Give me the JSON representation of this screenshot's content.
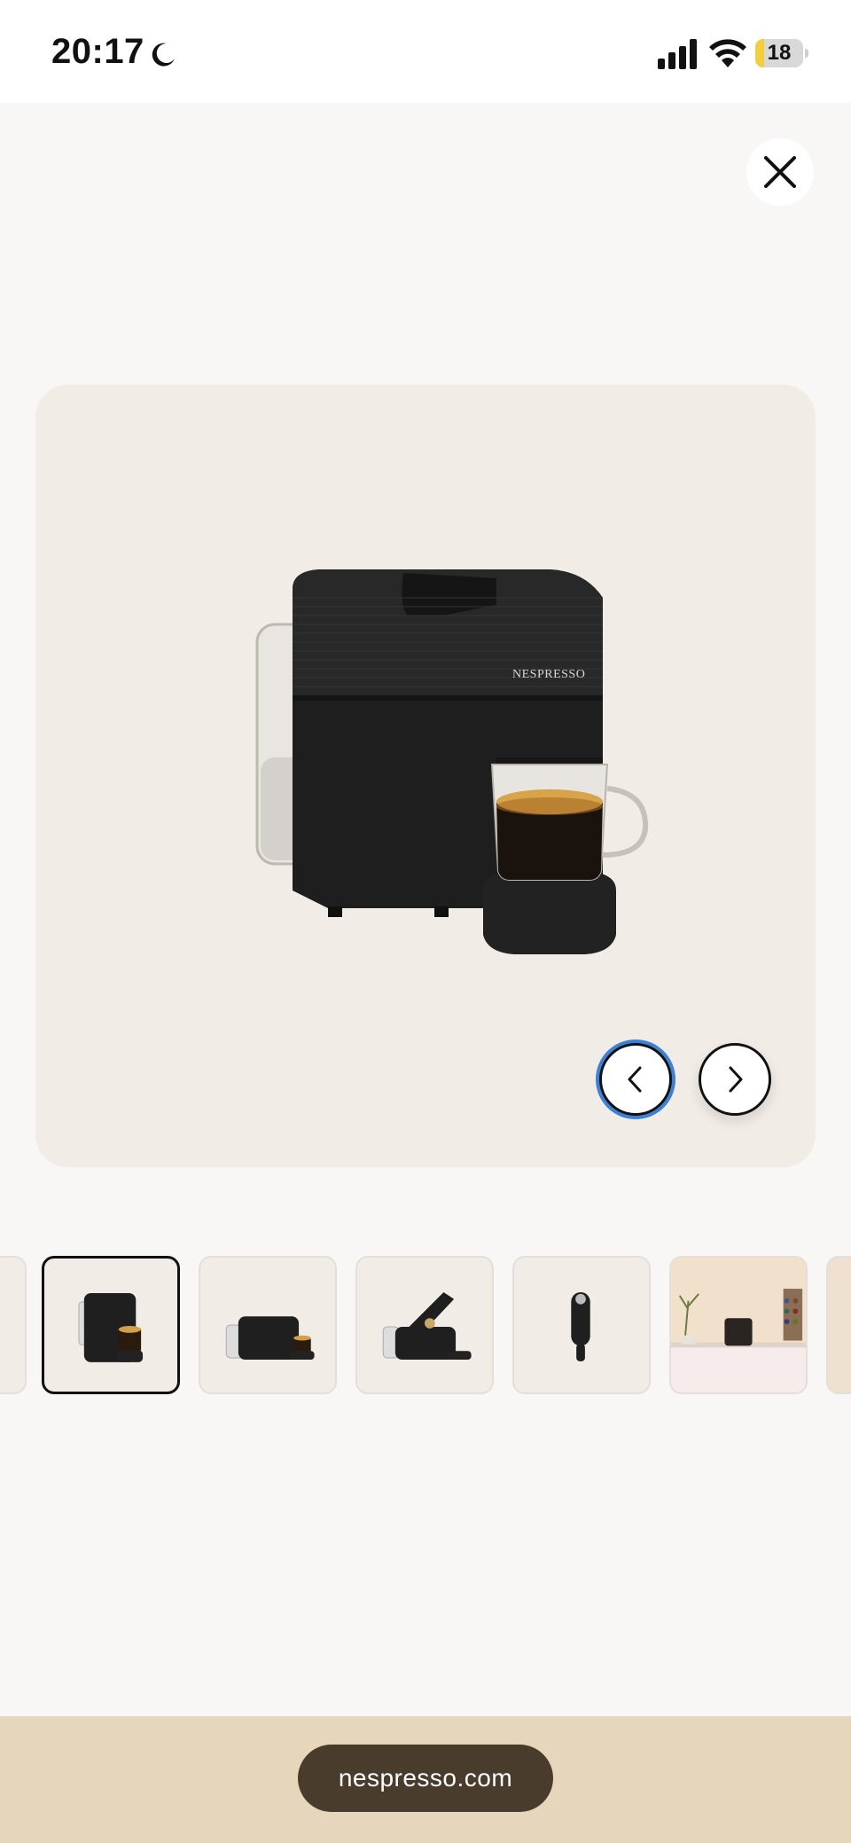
{
  "status_bar": {
    "time": "20:17",
    "battery_level": "18",
    "icons": [
      "moon-icon",
      "cellular-signal-icon",
      "wifi-icon",
      "battery-icon"
    ]
  },
  "gallery": {
    "close_icon": "close-icon",
    "prev_icon": "chevron-left-icon",
    "next_icon": "chevron-right-icon",
    "main_image": "coffee-machine-image",
    "brand_on_machine": "NESPRESSO",
    "thumbnails": [
      "coffee-machine-front",
      "coffee-machine-side",
      "coffee-machine-open",
      "capsule-holder",
      "coffee-machine-kitchen"
    ]
  },
  "browser": {
    "url": "nespresso.com"
  },
  "colors": {
    "stage_bg": "#f1ece5",
    "page_bg": "#f8f7f5",
    "bottom_bar": "#e6d6bb",
    "url_pill": "#4a3c2c",
    "focus_ring": "#3b82d6"
  }
}
